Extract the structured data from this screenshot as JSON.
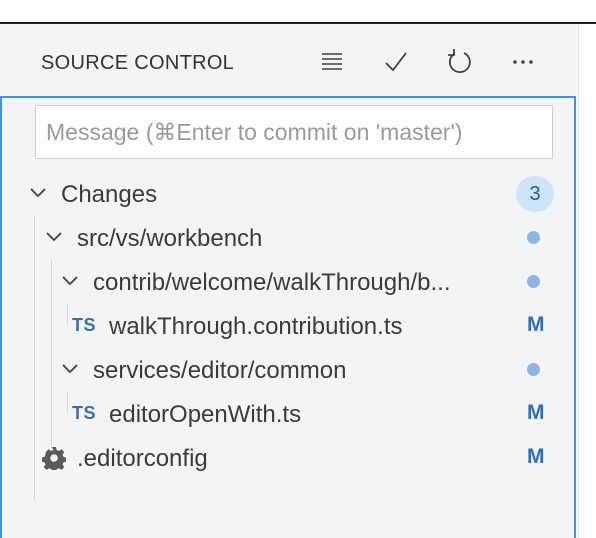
{
  "header": {
    "title": "SOURCE CONTROL",
    "icons": [
      "list-view-icon",
      "commit-check-icon",
      "refresh-icon",
      "more-actions-icon"
    ]
  },
  "commit": {
    "placeholder": "Message (⌘Enter to commit on 'master')",
    "value": ""
  },
  "changes": {
    "label": "Changes",
    "count": "3"
  },
  "tree": [
    {
      "label": "src/vs/workbench",
      "type": "folder"
    },
    {
      "label": "contrib/welcome/walkThrough/b...",
      "type": "folder"
    },
    {
      "label": "walkThrough.contribution.ts",
      "type": "file",
      "icon": "TS",
      "status": "M"
    },
    {
      "label": "services/editor/common",
      "type": "folder"
    },
    {
      "label": "editorOpenWith.ts",
      "type": "file",
      "icon": "TS",
      "status": "M"
    },
    {
      "label": ".editorconfig",
      "type": "file",
      "icon": "gear-icon",
      "status": "M"
    }
  ],
  "colors": {
    "accent_border": "#4a90e2",
    "badge_bg": "#cfe4f7",
    "modified": "#2f6fb5",
    "folder_dot": "#8fb5e6"
  }
}
